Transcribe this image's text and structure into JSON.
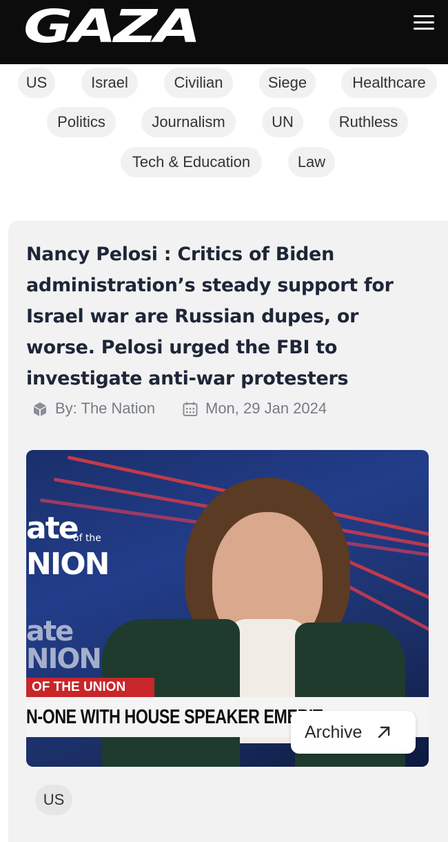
{
  "header": {
    "logo_text": "GAZA",
    "menu_icon": "hamburger-menu-icon"
  },
  "tags": [
    {
      "label": "US"
    },
    {
      "label": "Israel"
    },
    {
      "label": "Civilian"
    },
    {
      "label": "Siege"
    },
    {
      "label": "Healthcare"
    },
    {
      "label": "Politics"
    },
    {
      "label": "Journalism"
    },
    {
      "label": "UN"
    },
    {
      "label": "Ruthless"
    },
    {
      "label": "Tech & Education"
    },
    {
      "label": "Law"
    }
  ],
  "article": {
    "title": "Nancy Pelosi : Critics of Biden administration’s steady support for Israel war are Russian dupes, or worse. Pelosi urged the FBI to investigate anti-war protesters",
    "author": "By: The Nation",
    "date": "Mon, 29 Jan 2024",
    "author_icon": "cube-icon",
    "date_icon": "calendar-icon",
    "image": {
      "overlay_top": "ate",
      "overlay_of_the": "of the",
      "overlay_union": "NION",
      "overlay_top_2": "ate",
      "overlay_union_2": "NION",
      "chyron_red": "OF THE UNION",
      "chyron_main": "N-ONE WITH HOUSE SPEAKER EMERIT"
    },
    "archive_label": "Archive",
    "archive_icon": "arrow-up-right-icon",
    "footer_tag": "US"
  },
  "colors": {
    "header_bg": "#0c0c0c",
    "tag_bg": "#f1f1f1",
    "card_bg": "#f2f2f2",
    "title": "#1e2638",
    "meta": "#777b85",
    "chyron_red": "#c8262a"
  }
}
